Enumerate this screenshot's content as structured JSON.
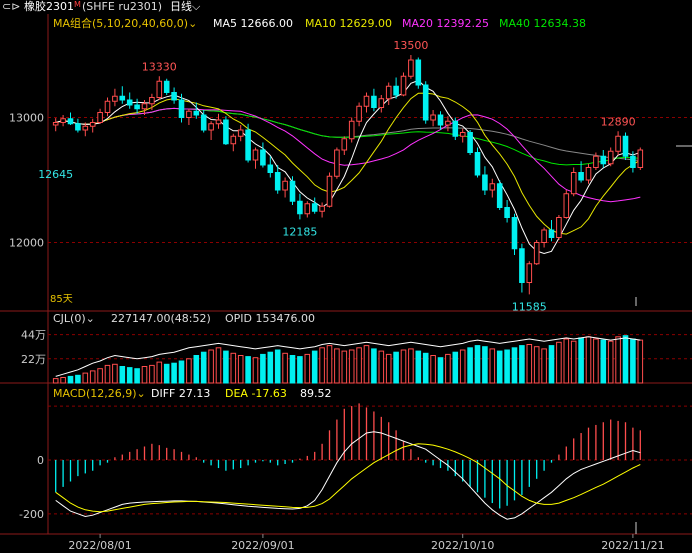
{
  "header": {
    "back_glyph": "⊂⊳",
    "instrument": "橡胶2301",
    "marker": "M",
    "code": "(SHFE ru2301)",
    "period": "日线"
  },
  "colors": {
    "up": "#ff4d4d",
    "down": "#00f0f0",
    "ma5": "#ffffff",
    "ma10": "#e6e600",
    "ma20": "#ff33ff",
    "ma40": "#00e600",
    "ma60": "#888888",
    "grid": "#8b0000",
    "frame": "#8b1a1a",
    "axis_text": "#cccccc",
    "macd_diff": "#ffffff",
    "macd_dea": "#ffff00"
  },
  "chart_data": [
    {
      "type": "candlestick",
      "title": "MA组合(5,10,20,40,60,0)",
      "legend": [
        {
          "name": "MA5",
          "value": "12666.00"
        },
        {
          "name": "MA10",
          "value": "12629.00"
        },
        {
          "name": "MA20",
          "value": "12392.25"
        },
        {
          "name": "MA40",
          "value": "12634.38"
        }
      ],
      "y_ticks": [
        "13000",
        "12000"
      ],
      "ylim": [
        11500,
        13700
      ],
      "x_ticks": [
        "2022/08/01",
        "2022/09/01",
        "2022/10/10",
        "2022/11/21"
      ],
      "annotations": [
        {
          "label": "13330",
          "value": 13330
        },
        {
          "label": "12645",
          "value": 12645
        },
        {
          "label": "12185",
          "value": 12185
        },
        {
          "label": "13500",
          "value": 13500
        },
        {
          "label": "11585",
          "value": 11585
        },
        {
          "label": "12890",
          "value": 12890
        }
      ],
      "corner_label": "85天",
      "candles": [
        [
          12940,
          12995,
          12890,
          12960
        ],
        [
          12960,
          13020,
          12930,
          12990
        ],
        [
          12990,
          13040,
          12940,
          12950
        ],
        [
          12950,
          12990,
          12880,
          12900
        ],
        [
          12900,
          12960,
          12850,
          12930
        ],
        [
          12930,
          12990,
          12880,
          12960
        ],
        [
          12960,
          13070,
          12950,
          13040
        ],
        [
          13040,
          13160,
          13010,
          13130
        ],
        [
          13130,
          13230,
          13090,
          13170
        ],
        [
          13170,
          13250,
          13110,
          13140
        ],
        [
          13140,
          13200,
          13070,
          13100
        ],
        [
          13100,
          13150,
          13030,
          13070
        ],
        [
          13070,
          13140,
          13020,
          13110
        ],
        [
          13110,
          13190,
          13060,
          13160
        ],
        [
          13160,
          13330,
          13140,
          13290
        ],
        [
          13290,
          13310,
          13180,
          13200
        ],
        [
          13200,
          13240,
          13110,
          13140
        ],
        [
          13140,
          13190,
          12960,
          13000
        ],
        [
          13000,
          13070,
          12940,
          13050
        ],
        [
          13050,
          13120,
          12990,
          13020
        ],
        [
          13020,
          13060,
          12880,
          12900
        ],
        [
          12900,
          12970,
          12820,
          12950
        ],
        [
          12950,
          13030,
          12910,
          12980
        ],
        [
          12980,
          13010,
          12780,
          12790
        ],
        [
          12790,
          12870,
          12730,
          12850
        ],
        [
          12850,
          12940,
          12810,
          12900
        ],
        [
          12900,
          12950,
          12640,
          12660
        ],
        [
          12660,
          12760,
          12590,
          12740
        ],
        [
          12740,
          12800,
          12600,
          12620
        ],
        [
          12620,
          12690,
          12520,
          12560
        ],
        [
          12560,
          12620,
          12390,
          12420
        ],
        [
          12420,
          12520,
          12360,
          12490
        ],
        [
          12490,
          12530,
          12300,
          12330
        ],
        [
          12330,
          12390,
          12185,
          12230
        ],
        [
          12230,
          12330,
          12200,
          12310
        ],
        [
          12310,
          12360,
          12230,
          12250
        ],
        [
          12250,
          12320,
          12200,
          12290
        ],
        [
          12290,
          12560,
          12280,
          12530
        ],
        [
          12530,
          12760,
          12510,
          12740
        ],
        [
          12740,
          12850,
          12700,
          12830
        ],
        [
          12830,
          13000,
          12800,
          12970
        ],
        [
          12970,
          13120,
          12930,
          13090
        ],
        [
          13090,
          13200,
          13040,
          13170
        ],
        [
          13170,
          13230,
          13050,
          13080
        ],
        [
          13080,
          13180,
          13040,
          13150
        ],
        [
          13150,
          13280,
          13100,
          13250
        ],
        [
          13250,
          13320,
          13150,
          13180
        ],
        [
          13180,
          13360,
          13170,
          13330
        ],
        [
          13330,
          13500,
          13310,
          13460
        ],
        [
          13460,
          13480,
          13230,
          13260
        ],
        [
          13260,
          13290,
          12950,
          12980
        ],
        [
          12980,
          13060,
          12930,
          13020
        ],
        [
          13020,
          13050,
          12900,
          12940
        ],
        [
          12940,
          13010,
          12890,
          12970
        ],
        [
          12970,
          13000,
          12820,
          12850
        ],
        [
          12850,
          12910,
          12800,
          12880
        ],
        [
          12880,
          12900,
          12700,
          12720
        ],
        [
          12720,
          12760,
          12520,
          12540
        ],
        [
          12540,
          12610,
          12380,
          12420
        ],
        [
          12420,
          12510,
          12360,
          12470
        ],
        [
          12470,
          12500,
          12260,
          12280
        ],
        [
          12280,
          12340,
          12160,
          12200
        ],
        [
          12200,
          12230,
          11900,
          11950
        ],
        [
          11950,
          11990,
          11600,
          11680
        ],
        [
          11680,
          11850,
          11585,
          11830
        ],
        [
          11830,
          12020,
          11820,
          12000
        ],
        [
          12000,
          12120,
          11960,
          12100
        ],
        [
          12100,
          12180,
          12010,
          12040
        ],
        [
          12040,
          12220,
          12020,
          12200
        ],
        [
          12200,
          12420,
          12190,
          12390
        ],
        [
          12390,
          12600,
          12370,
          12560
        ],
        [
          12560,
          12650,
          12480,
          12500
        ],
        [
          12500,
          12630,
          12470,
          12600
        ],
        [
          12600,
          12720,
          12580,
          12690
        ],
        [
          12690,
          12740,
          12600,
          12630
        ],
        [
          12630,
          12760,
          12610,
          12730
        ],
        [
          12730,
          12890,
          12700,
          12850
        ],
        [
          12850,
          12880,
          12660,
          12690
        ],
        [
          12690,
          12730,
          12560,
          12600
        ],
        [
          12600,
          12760,
          12580,
          12740
        ]
      ]
    },
    {
      "type": "bar",
      "title": "CJL(0)",
      "legend": [
        {
          "name": "",
          "value": "227147.00(48:52)"
        },
        {
          "name": "OPID",
          "value": "153476.00"
        }
      ],
      "y_ticks": [
        "44万",
        "22万"
      ],
      "ylim": [
        0,
        500000
      ],
      "values": [
        40000,
        50000,
        60000,
        70000,
        90000,
        110000,
        130000,
        160000,
        170000,
        150000,
        140000,
        130000,
        150000,
        160000,
        190000,
        170000,
        180000,
        200000,
        220000,
        250000,
        280000,
        300000,
        320000,
        290000,
        270000,
        250000,
        240000,
        230000,
        260000,
        280000,
        300000,
        270000,
        250000,
        240000,
        260000,
        290000,
        320000,
        340000,
        310000,
        290000,
        300000,
        320000,
        340000,
        310000,
        290000,
        260000,
        280000,
        300000,
        310000,
        290000,
        270000,
        250000,
        230000,
        260000,
        280000,
        300000,
        320000,
        340000,
        330000,
        310000,
        290000,
        300000,
        320000,
        340000,
        350000,
        330000,
        310000,
        340000,
        370000,
        400000,
        380000,
        410000,
        420000,
        400000,
        390000,
        380000,
        420000,
        430000,
        400000,
        390000
      ],
      "line_values": [
        60000,
        80000,
        100000,
        120000,
        150000,
        180000,
        200000,
        230000,
        250000,
        240000,
        230000,
        220000,
        230000,
        240000,
        260000,
        270000,
        280000,
        300000,
        320000,
        330000,
        340000,
        350000,
        360000,
        350000,
        340000,
        330000,
        320000,
        310000,
        320000,
        330000,
        340000,
        330000,
        320000,
        310000,
        320000,
        330000,
        350000,
        360000,
        350000,
        340000,
        350000,
        360000,
        370000,
        360000,
        350000,
        340000,
        350000,
        360000,
        370000,
        360000,
        350000,
        340000,
        330000,
        340000,
        350000,
        360000,
        380000,
        390000,
        380000,
        370000,
        360000,
        370000,
        380000,
        390000,
        400000,
        390000,
        380000,
        390000,
        400000,
        410000,
        400000,
        410000,
        420000,
        410000,
        400000,
        390000,
        400000,
        410000,
        400000,
        390000
      ]
    },
    {
      "type": "macd",
      "title": "MACD(12,26,9)",
      "legend": [
        {
          "name": "DIFF",
          "value": "27.13"
        },
        {
          "name": "DEA",
          "value": "-17.63"
        },
        {
          "name": "",
          "value": "89.52"
        }
      ],
      "y_ticks": [
        "0",
        "-200"
      ],
      "ylim": [
        -260,
        230
      ],
      "macd_bars": [
        -120,
        -100,
        -80,
        -60,
        -50,
        -40,
        -20,
        -10,
        10,
        20,
        30,
        40,
        50,
        60,
        55,
        45,
        40,
        30,
        20,
        10,
        -10,
        -20,
        -30,
        -40,
        -35,
        -30,
        -20,
        -10,
        -5,
        -10,
        -20,
        -15,
        -10,
        5,
        15,
        30,
        60,
        110,
        150,
        190,
        200,
        210,
        195,
        180,
        160,
        140,
        110,
        70,
        40,
        10,
        -10,
        -20,
        -30,
        -40,
        -60,
        -80,
        -100,
        -120,
        -140,
        -160,
        -180,
        -170,
        -150,
        -130,
        -100,
        -70,
        -40,
        -10,
        20,
        50,
        80,
        100,
        120,
        130,
        140,
        150,
        145,
        140,
        120,
        110
      ],
      "diff_values": [
        -150,
        -170,
        -190,
        -200,
        -210,
        -205,
        -195,
        -185,
        -175,
        -165,
        -160,
        -158,
        -156,
        -155,
        -154,
        -153,
        -152,
        -152,
        -153,
        -154,
        -156,
        -158,
        -160,
        -163,
        -166,
        -169,
        -172,
        -174,
        -176,
        -178,
        -180,
        -181,
        -182,
        -180,
        -170,
        -150,
        -110,
        -60,
        -10,
        30,
        60,
        80,
        100,
        105,
        100,
        90,
        80,
        70,
        60,
        50,
        40,
        20,
        0,
        -20,
        -45,
        -70,
        -100,
        -130,
        -160,
        -185,
        -205,
        -220,
        -215,
        -200,
        -180,
        -160,
        -140,
        -120,
        -95,
        -70,
        -50,
        -35,
        -25,
        -15,
        -5,
        5,
        15,
        25,
        35,
        27
      ],
      "dea_values": [
        -120,
        -140,
        -160,
        -175,
        -185,
        -190,
        -192,
        -190,
        -185,
        -180,
        -175,
        -170,
        -165,
        -162,
        -160,
        -158,
        -156,
        -155,
        -154,
        -154,
        -155,
        -156,
        -157,
        -158,
        -160,
        -162,
        -164,
        -166,
        -168,
        -170,
        -172,
        -174,
        -176,
        -177,
        -176,
        -172,
        -162,
        -145,
        -120,
        -95,
        -70,
        -50,
        -30,
        -10,
        5,
        20,
        35,
        48,
        55,
        60,
        58,
        55,
        48,
        40,
        30,
        18,
        5,
        -10,
        -30,
        -50,
        -70,
        -95,
        -115,
        -135,
        -150,
        -160,
        -165,
        -165,
        -160,
        -150,
        -140,
        -128,
        -115,
        -102,
        -90,
        -75,
        -60,
        -45,
        -30,
        -17
      ]
    }
  ]
}
